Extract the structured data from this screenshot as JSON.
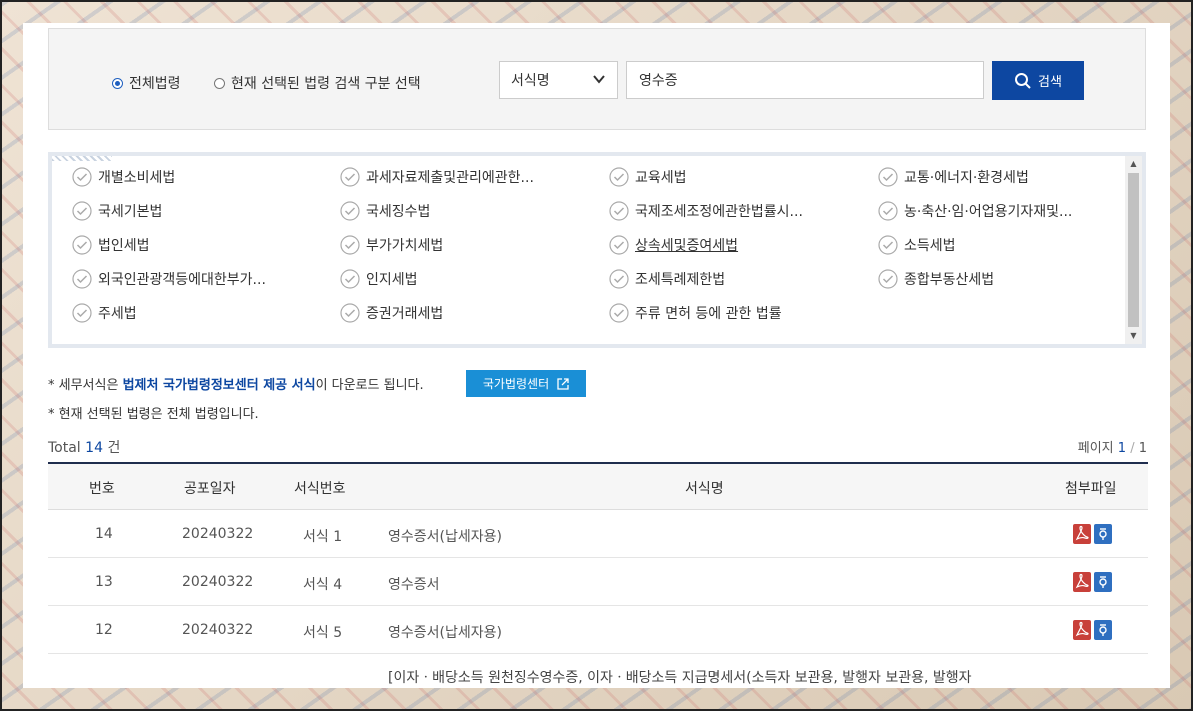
{
  "search": {
    "radio_all": "전체법령",
    "radio_selected": "현재 선택된 법령 검색 구분 선택",
    "select_value": "서식명",
    "input_value": "영수증",
    "button_label": "검색"
  },
  "laws": [
    [
      "개별소비세법",
      "과세자료제출및관리에관한...",
      "교육세법",
      "교통·에너지·환경세법"
    ],
    [
      "국세기본법",
      "국세징수법",
      "국제조세조정에관한법률시...",
      "농·축산·임·어업용기자재및..."
    ],
    [
      "법인세법",
      "부가가치세법",
      "상속세및증여세법",
      "소득세법"
    ],
    [
      "외국인관광객등에대한부가...",
      "인지세법",
      "조세특례제한법",
      "종합부동산세법"
    ],
    [
      "주세법",
      "증권거래세법",
      "주류 면허 등에 관한 법률",
      ""
    ]
  ],
  "notes": {
    "line1_prefix": "* 세무서식은 ",
    "line1_bold": "법제처 국가법령정보센터 제공 서식",
    "line1_suffix": "이 다운로드 됩니다.",
    "center_button": "국가법령센터",
    "line2": "* 현재 선택된 법령은 전체 법령입니다."
  },
  "summary": {
    "total_label": "Total",
    "total_count": "14",
    "total_unit": "건",
    "page_label": "페이지",
    "page_current": "1",
    "page_sep": "/",
    "page_total": "1"
  },
  "table": {
    "headers": [
      "번호",
      "공포일자",
      "서식번호",
      "서식명",
      "첨부파일"
    ],
    "rows": [
      {
        "no": "14",
        "date": "20240322",
        "form_no": "서식 1",
        "name": "영수증서(납세자용)"
      },
      {
        "no": "13",
        "date": "20240322",
        "form_no": "서식 4",
        "name": "영수증서"
      },
      {
        "no": "12",
        "date": "20240322",
        "form_no": "서식 5",
        "name": "영수증서(납세자용)"
      }
    ],
    "partial_row_text": "[이자ㆍ배당소득 원천징수영수증, 이자ㆍ배당소득 지급명세서(소득자 보관용, 발행자 보관용, 발행자"
  },
  "colors": {
    "primary": "#0d47a1",
    "accent_button": "#1a8fd6",
    "pdf_red": "#c8403a",
    "hwp_blue": "#2f6fc0"
  }
}
